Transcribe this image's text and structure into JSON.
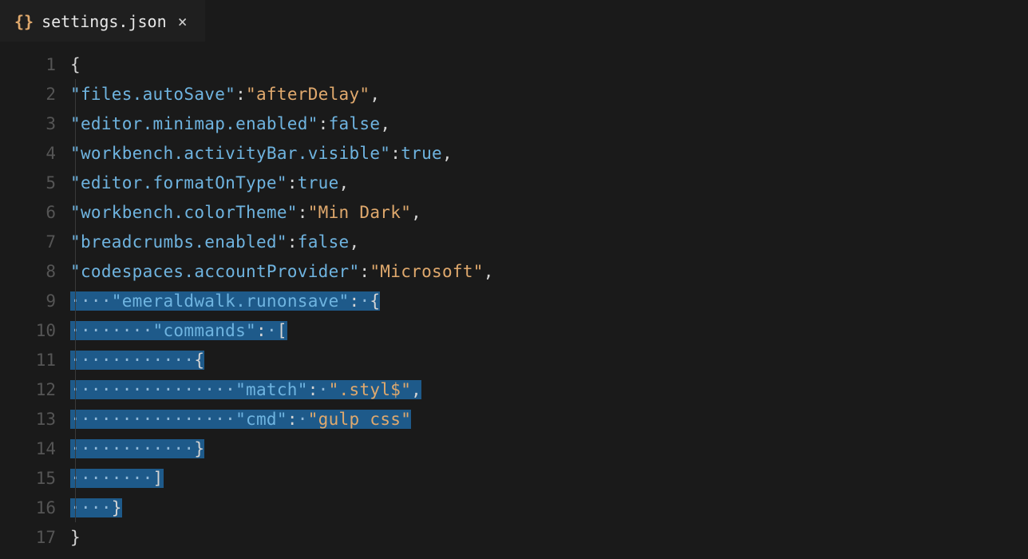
{
  "tab": {
    "icon": "{}",
    "filename": "settings.json",
    "close": "×"
  },
  "lineNumbers": [
    "1",
    "2",
    "3",
    "4",
    "5",
    "6",
    "7",
    "8",
    "9",
    "10",
    "11",
    "12",
    "13",
    "14",
    "15",
    "16",
    "17"
  ],
  "selection": {
    "startLine": 9,
    "endLine": 16
  },
  "code": {
    "l1_open": "{",
    "l2_key": "\"files.autoSave\"",
    "l2_val": "\"afterDelay\"",
    "l3_key": "\"editor.minimap.enabled\"",
    "l3_val": "false",
    "l4_key": "\"workbench.activityBar.visible\"",
    "l4_val": "true",
    "l5_key": "\"editor.formatOnType\"",
    "l5_val": "true",
    "l6_key": "\"workbench.colorTheme\"",
    "l6_val": "\"Min Dark\"",
    "l7_key": "\"breadcrumbs.enabled\"",
    "l7_val": "false",
    "l8_key": "\"codespaces.accountProvider\"",
    "l8_val": "\"Microsoft\"",
    "l9_key": "\"emeraldwalk.runonsave\"",
    "l9_open": "{",
    "l10_key": "\"commands\"",
    "l10_open": "[",
    "l11_open": "{",
    "l12_key": "\"match\"",
    "l12_val": "\".styl$\"",
    "l13_key": "\"cmd\"",
    "l13_val": "\"gulp css\"",
    "l14_close": "}",
    "l15_close": "]",
    "l16_close": "}",
    "l17_close": "}",
    "colon": ":",
    "comma": ","
  },
  "ws4": "····",
  "ws8": "········",
  "ws12": "············",
  "ws16": "················"
}
